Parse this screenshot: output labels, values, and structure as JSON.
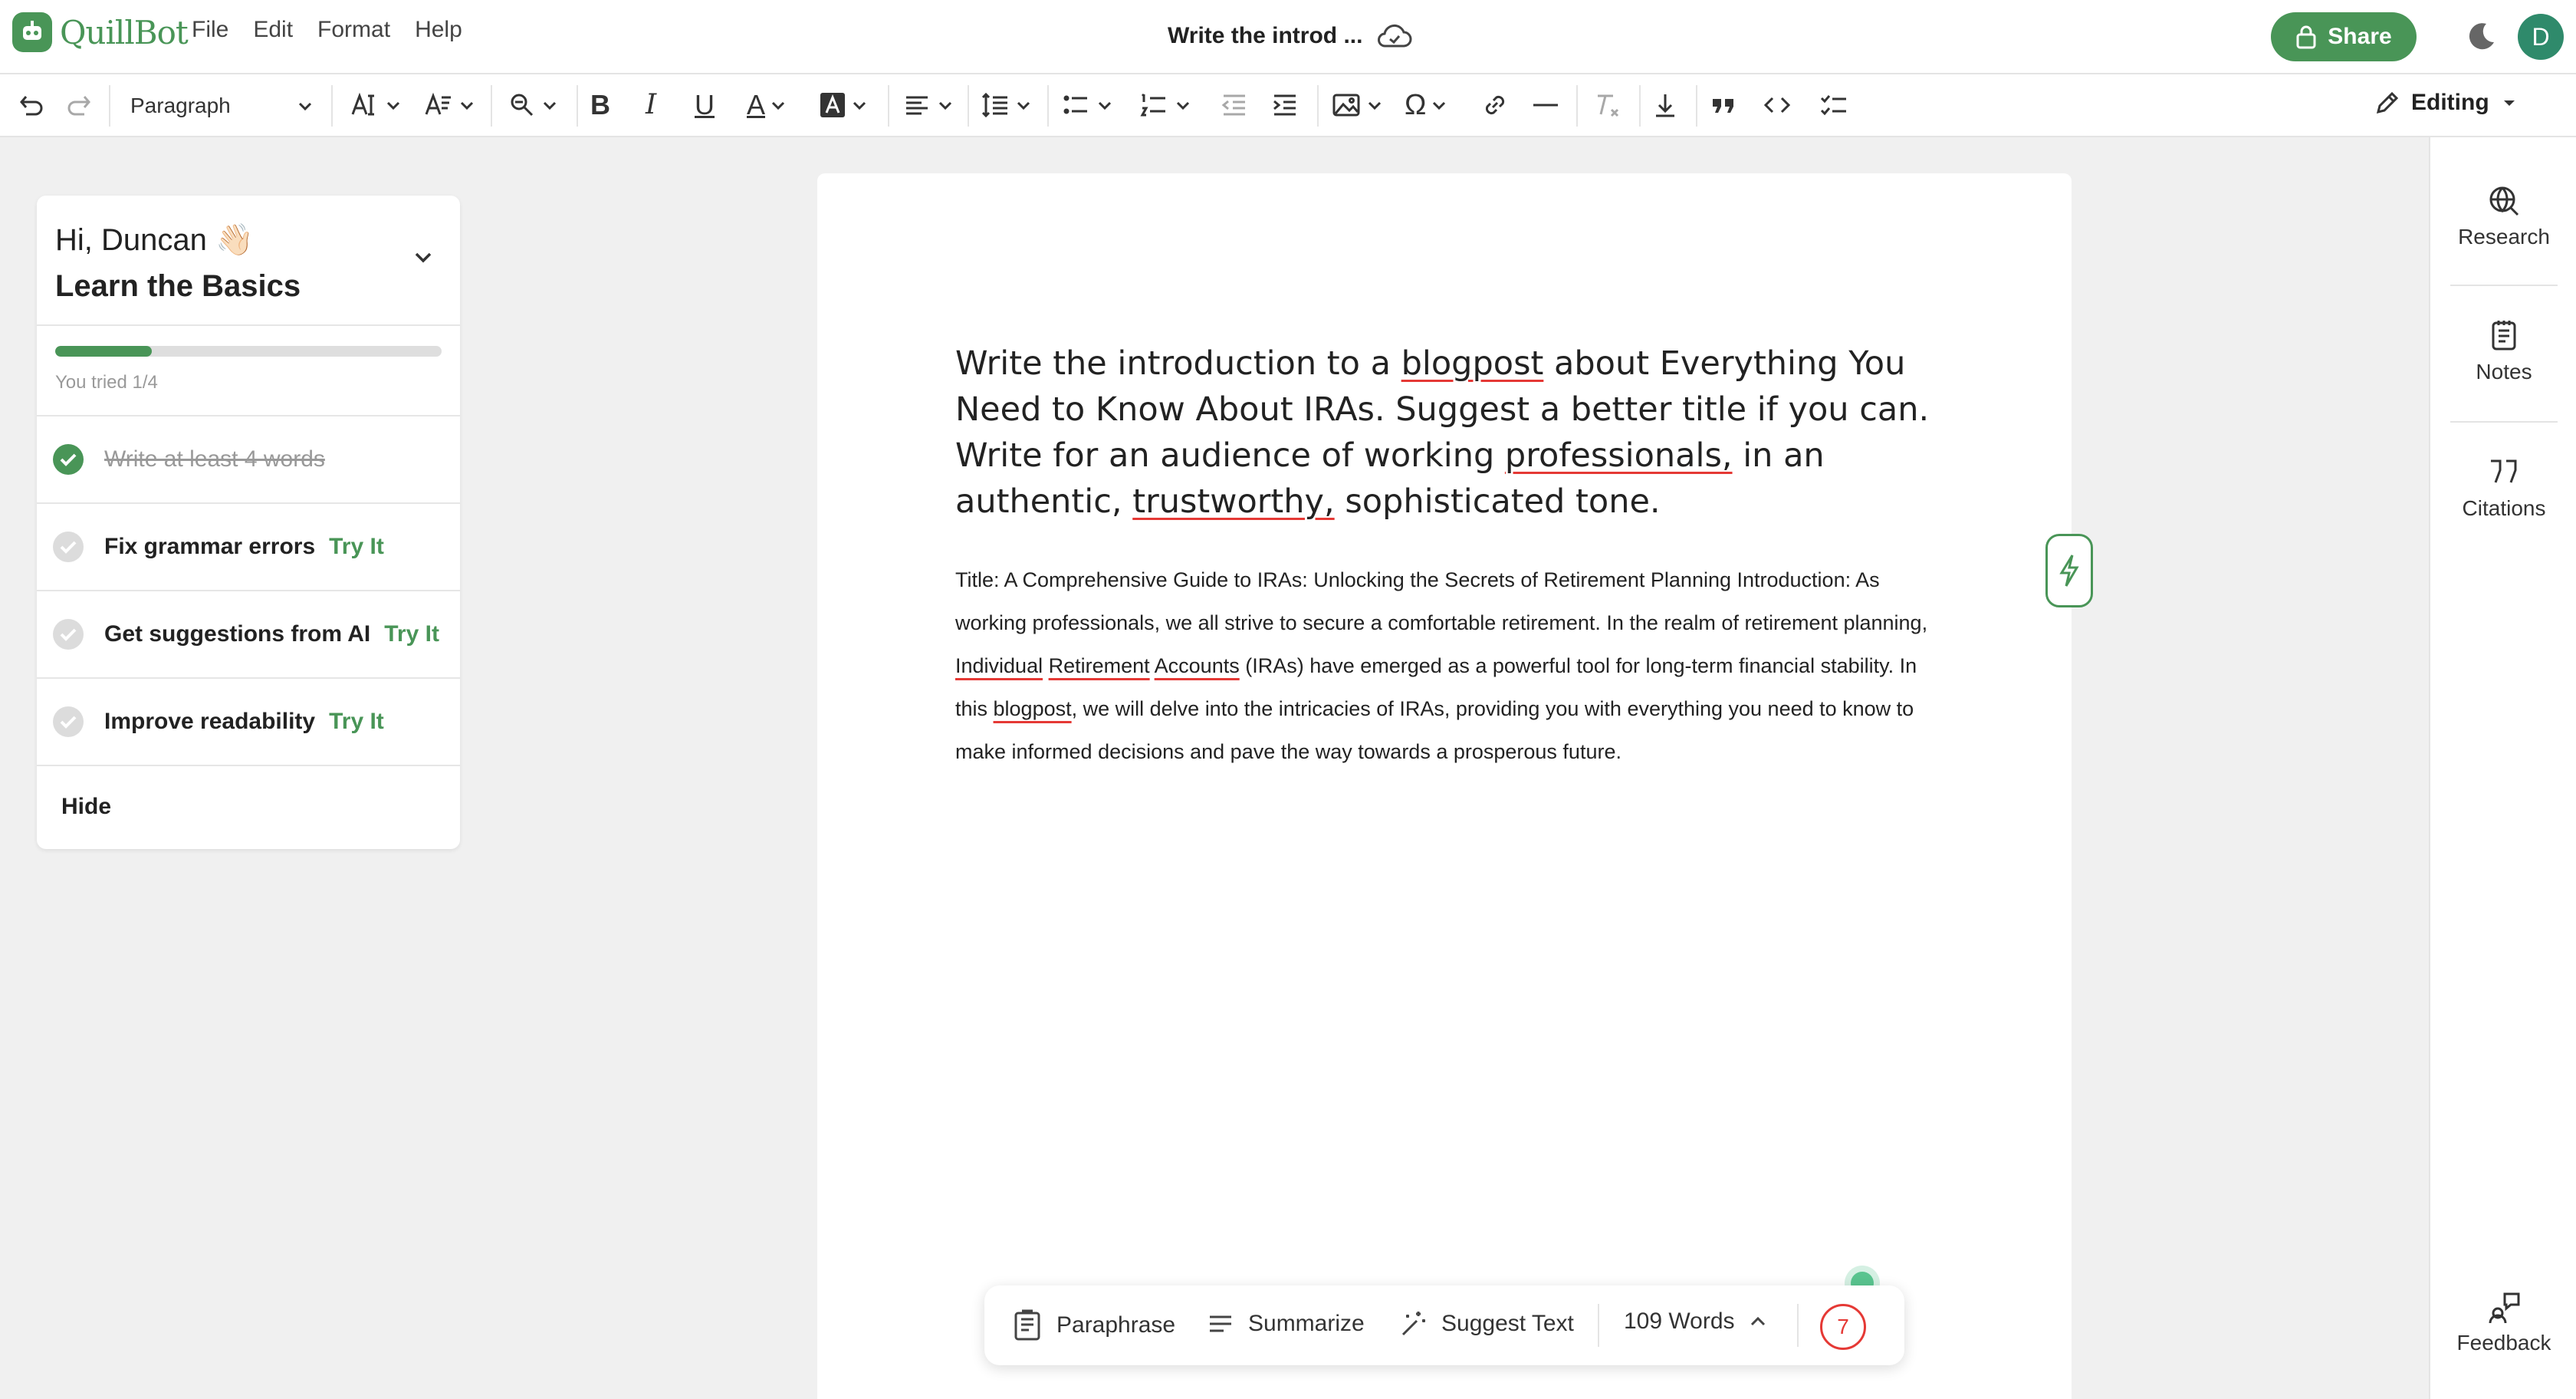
{
  "app": {
    "name": "QuillBot",
    "menu": [
      "File",
      "Edit",
      "Format",
      "Help"
    ],
    "doc_title": "Write the introd ...",
    "share_label": "Share",
    "avatar_initial": "D"
  },
  "toolbar": {
    "paragraph_style": "Paragraph",
    "mode_label": "Editing"
  },
  "learn": {
    "greeting": "Hi, Duncan 👋🏻",
    "title": "Learn the Basics",
    "progress": 0.25,
    "tried_text": "You tried 1/4",
    "tasks": [
      {
        "label": "Write at least 4 words",
        "done": true
      },
      {
        "label": "Fix grammar errors",
        "try": "Try It"
      },
      {
        "label": "Get suggestions from AI",
        "try": "Try It"
      },
      {
        "label": "Improve readability",
        "try": "Try It"
      }
    ],
    "hide_label": "Hide"
  },
  "document": {
    "prompt": [
      "Write the introduction to a ",
      "blogpost",
      " about Everything You Need to Know About IRAs. Suggest a better title if you can. Write for an audience of working ",
      "professionals,",
      " in an authentic, ",
      "trustworthy,",
      " sophisticated tone."
    ],
    "body": [
      "Title: A Comprehensive Guide to IRAs: Unlocking the Secrets of Retirement Planning Introduction: As working professionals, we all strive to secure a comfortable retirement. In the realm of retirement planning, ",
      "Individual",
      " ",
      "Retirement",
      " ",
      "Accounts",
      " (IRAs) have emerged as a powerful tool for long-term financial stability. In this ",
      "blogpost",
      ", we will delve into the intricacies of IRAs, providing you with everything you need to know to make informed decisions and pave the way towards a prosperous future."
    ]
  },
  "actionbar": {
    "paraphrase": "Paraphrase",
    "summarize": "Summarize",
    "suggest": "Suggest Text",
    "word_count": "109 Words",
    "issues": "7"
  },
  "rail": {
    "research": "Research",
    "notes": "Notes",
    "citations": "Citations",
    "feedback": "Feedback"
  },
  "colors": {
    "brand": "#499557",
    "error": "#e53935"
  }
}
